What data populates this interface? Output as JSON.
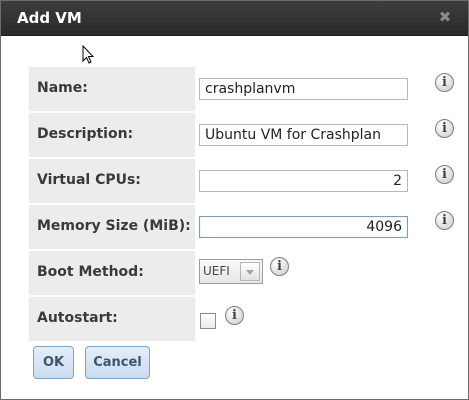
{
  "dialog": {
    "title": "Add VM",
    "close_icon": "close-icon"
  },
  "fields": {
    "name": {
      "label": "Name:",
      "value": "crashplanvm"
    },
    "description": {
      "label": "Description:",
      "value": "Ubuntu VM for Crashplan"
    },
    "vcpus": {
      "label": "Virtual CPUs:",
      "value": "2"
    },
    "memory": {
      "label": "Memory Size (MiB):",
      "value": "4096"
    },
    "boot_method": {
      "label": "Boot Method:",
      "selected": "UEFI"
    },
    "autostart": {
      "label": "Autostart:",
      "checked": false
    }
  },
  "buttons": {
    "ok": "OK",
    "cancel": "Cancel"
  },
  "colors": {
    "titlebar": "#333333",
    "label_bg": "#ececec",
    "button_bg": "#d5e5f4",
    "button_border": "#7fa3c4"
  }
}
